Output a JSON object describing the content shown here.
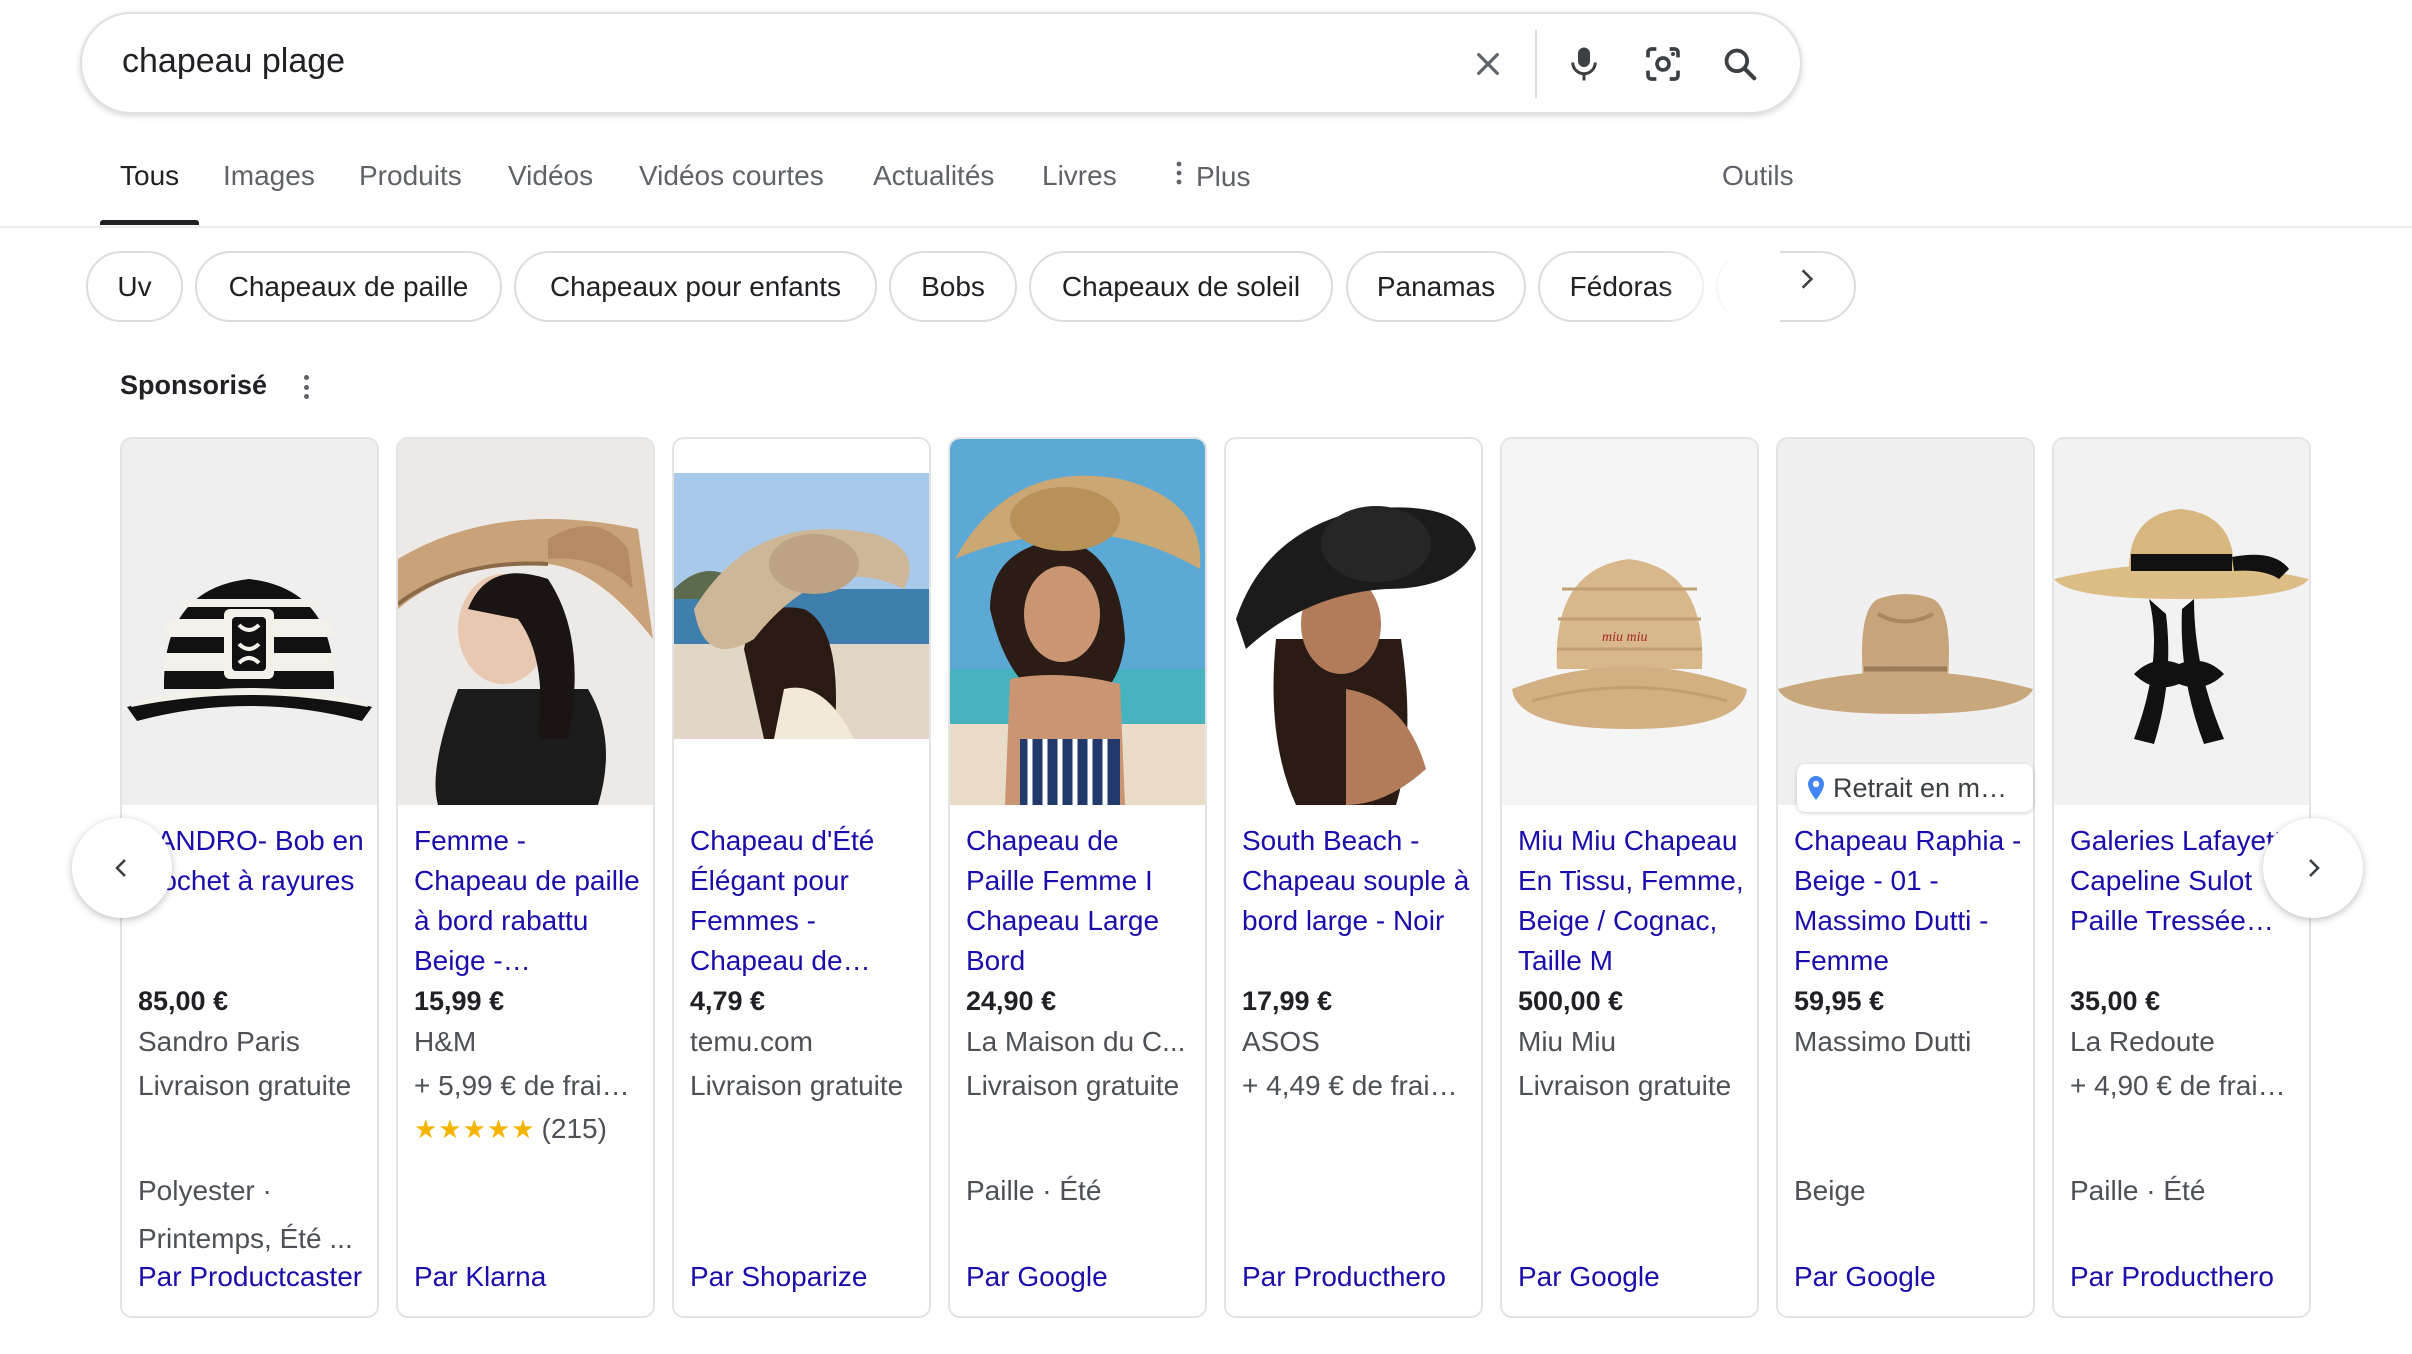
{
  "search": {
    "query": "chapeau plage"
  },
  "tabs": [
    {
      "label": "Tous",
      "active": true
    },
    {
      "label": "Images"
    },
    {
      "label": "Produits"
    },
    {
      "label": "Vidéos"
    },
    {
      "label": "Vidéos courtes"
    },
    {
      "label": "Actualités"
    },
    {
      "label": "Livres"
    },
    {
      "label": "Plus"
    },
    {
      "label": "Outils"
    }
  ],
  "chips": [
    "Uv",
    "Chapeaux de paille",
    "Chapeaux pour enfants",
    "Bobs",
    "Chapeaux de soleil",
    "Panamas",
    "Fédoras"
  ],
  "sponsored_label": "Sponsorisé",
  "products": [
    {
      "title": "SANDRO- Bob en crochet à rayures",
      "price": "85,00 €",
      "store": "Sandro Paris",
      "shipping": "Livraison gratuite",
      "attr1": "Polyester ·",
      "attr2": "Printemps, Été ...",
      "byline": "Par Productcaster"
    },
    {
      "title": "Femme - Chapeau de paille à bord rabattu Beige -…",
      "price": "15,99 €",
      "store": "H&M",
      "shipping": "+ 5,99 € de frai…",
      "rating_stars": "★★★★★",
      "rating_count": "(215)",
      "byline": "Par Klarna"
    },
    {
      "title": "Chapeau d'Été Élégant pour Femmes - Chapeau de…",
      "price": "4,79 €",
      "store": "temu.com",
      "shipping": "Livraison gratuite",
      "byline": "Par Shoparize"
    },
    {
      "title": "Chapeau de Paille Femme I Chapeau Large Bord",
      "price": "24,90 €",
      "store": "La Maison du C...",
      "shipping": "Livraison gratuite",
      "attr1": "Paille · Été",
      "byline": "Par Google"
    },
    {
      "title": "South Beach - Chapeau souple à bord large - Noir",
      "price": "17,99 €",
      "store": "ASOS",
      "shipping": "+ 4,49 € de frai…",
      "byline": "Par Producthero"
    },
    {
      "title": "Miu Miu Chapeau En Tissu, Femme, Beige / Cognac, Taille M",
      "price": "500,00 €",
      "store": "Miu Miu",
      "shipping": "Livraison gratuite",
      "byline": "Par Google"
    },
    {
      "title": "Chapeau Raphia - Beige - 01 - Massimo Dutti - Femme",
      "price": "59,95 €",
      "store": "Massimo Dutti",
      "attr1": "Beige",
      "pickup": "Retrait en m…",
      "byline": "Par Google"
    },
    {
      "title": "Galeries Lafayette Capeline Sulot Paille Tressée…",
      "price": "35,00 €",
      "store": "La Redoute",
      "shipping": "+ 4,90 € de frai…",
      "attr1": "Paille · Été",
      "byline": "Par Producthero"
    }
  ],
  "colors": {
    "link": "#1a0dab",
    "text": "#202124",
    "secondary": "#4d5156",
    "star": "#f4b400"
  }
}
